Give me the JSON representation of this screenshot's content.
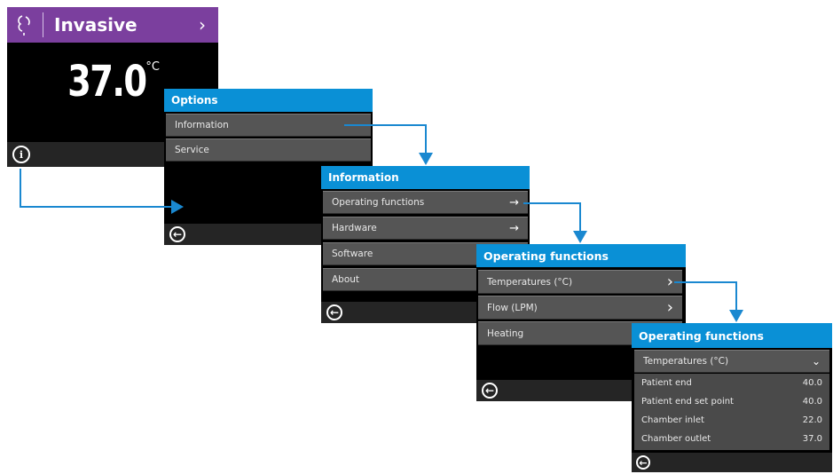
{
  "home": {
    "mode_label": "Invasive",
    "temperature": "37.0",
    "temperature_unit": "°C",
    "info_icon": "info-icon",
    "mode_icon": "patient-airway-icon",
    "nav_icon": "chevron-right-icon"
  },
  "options": {
    "title": "Options",
    "items": [
      {
        "label": "Information"
      },
      {
        "label": "Service"
      }
    ],
    "back_icon": "back-arrow-icon"
  },
  "information": {
    "title": "Information",
    "items": [
      {
        "label": "Operating functions",
        "arrow": "→"
      },
      {
        "label": "Hardware",
        "arrow": "→"
      },
      {
        "label": "Software",
        "arrow": ""
      },
      {
        "label": "About",
        "arrow": ""
      }
    ],
    "back_icon": "back-arrow-icon"
  },
  "operating": {
    "title": "Operating functions",
    "items": [
      {
        "label": "Temperatures (°C)",
        "arrow": "›"
      },
      {
        "label": "Flow (LPM)",
        "arrow": "›"
      },
      {
        "label": "Heating",
        "arrow": ""
      }
    ],
    "back_icon": "back-arrow-icon"
  },
  "temperatures": {
    "title": "Operating functions",
    "dropdown_label": "Temperatures (°C)",
    "rows": [
      {
        "label": "Patient end",
        "value": "40.0"
      },
      {
        "label": "Patient end set point",
        "value": "40.0"
      },
      {
        "label": "Chamber inlet",
        "value": "22.0"
      },
      {
        "label": "Chamber outlet",
        "value": "37.0"
      }
    ],
    "back_icon": "back-arrow-icon"
  },
  "colors": {
    "header_blue": "#0a90d6",
    "mode_purple": "#7b3f9e",
    "connector": "#1a88d0",
    "item_gray": "#555555"
  }
}
